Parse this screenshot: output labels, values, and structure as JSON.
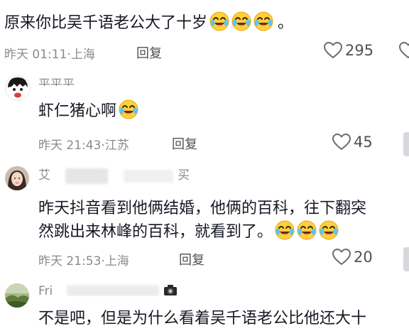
{
  "comments": [
    {
      "text": "原来你比吴千语老公大了十岁",
      "text_suffix": "。",
      "time": "昨天 01:11",
      "location": "上海",
      "reply_label": "回复",
      "likes": "295",
      "emoji_count": 3
    },
    {
      "username": "平平平",
      "text": "虾仁猪心啊",
      "time": "昨天 21:43",
      "location": "江苏",
      "reply_label": "回复",
      "likes": "45",
      "emoji_count": 1
    },
    {
      "username": "艾",
      "username_suffix": "买",
      "text_line1": "昨天抖音看到他俩结婚，他俩的百科，往下翻突",
      "text_line2": "然跳出来林峰的百科，就看到了。",
      "time": "昨天 21:53",
      "location": "上海",
      "reply_label": "回复",
      "likes": "20",
      "emoji_count": 3
    },
    {
      "username": "Fri",
      "text": "不是吧，但是为什么看着吴千语老公比他还大十"
    }
  ],
  "colors": {
    "text": "#161823",
    "meta": "#8a8a8f",
    "reply": "#505055",
    "emoji": "#ffcf3f"
  },
  "separator": "·"
}
